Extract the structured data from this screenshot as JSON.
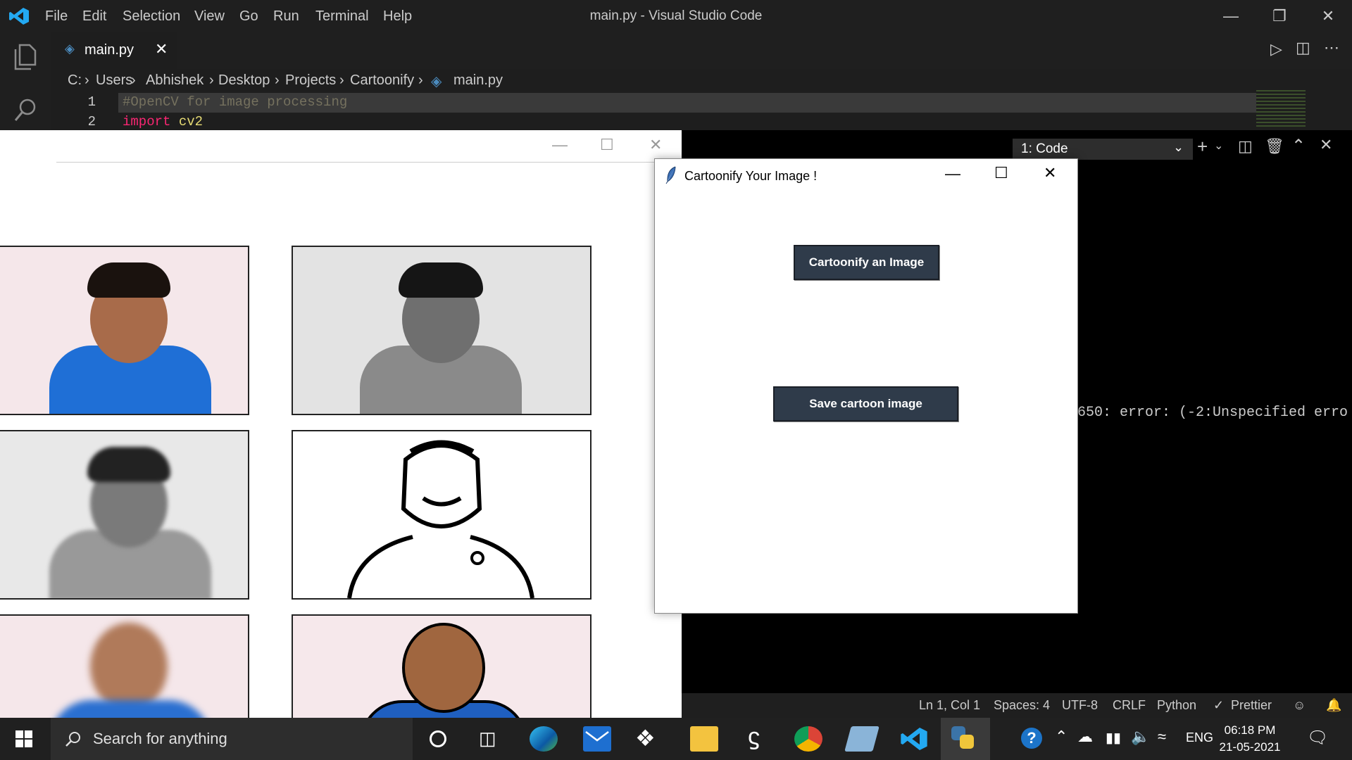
{
  "titlebar": {
    "menus": [
      "File",
      "Edit",
      "Selection",
      "View",
      "Go",
      "Run",
      "Terminal",
      "Help"
    ],
    "window_title": "main.py - Visual Studio Code"
  },
  "tabs": [
    {
      "label": "main.py"
    }
  ],
  "breadcrumb": [
    "C:",
    "Users",
    "Abhishek",
    "Desktop",
    "Projects",
    "Cartoonify",
    "main.py"
  ],
  "editor": {
    "lines": [
      {
        "number": "1",
        "text": "#OpenCV for image processing"
      },
      {
        "number": "2",
        "keyword": "import",
        "module": "cv2"
      }
    ]
  },
  "terminal": {
    "selector": "1: Code",
    "error_text": "650: error: (-2:Unspecified erro"
  },
  "tk_dialog": {
    "title": "Cartoonify Your Image !",
    "cartoonify_button": "Cartoonify an Image",
    "save_button": "Save cartoon image"
  },
  "statusbar": {
    "position": "Ln 1, Col 1",
    "spaces": "Spaces: 4",
    "encoding": "UTF-8",
    "eol": "CRLF",
    "language": "Python",
    "formatter": "Prettier"
  },
  "taskbar": {
    "search_placeholder": "Search for anything",
    "language": "ENG",
    "time": "06:18 PM",
    "date": "21-05-2021"
  },
  "colors": {
    "vscode_blue": "#23a9f2",
    "keyword_pink": "#f92672",
    "module_yellow": "#e6db74",
    "comment_gray": "#75715e",
    "tk_button": "#2f3b4a"
  }
}
